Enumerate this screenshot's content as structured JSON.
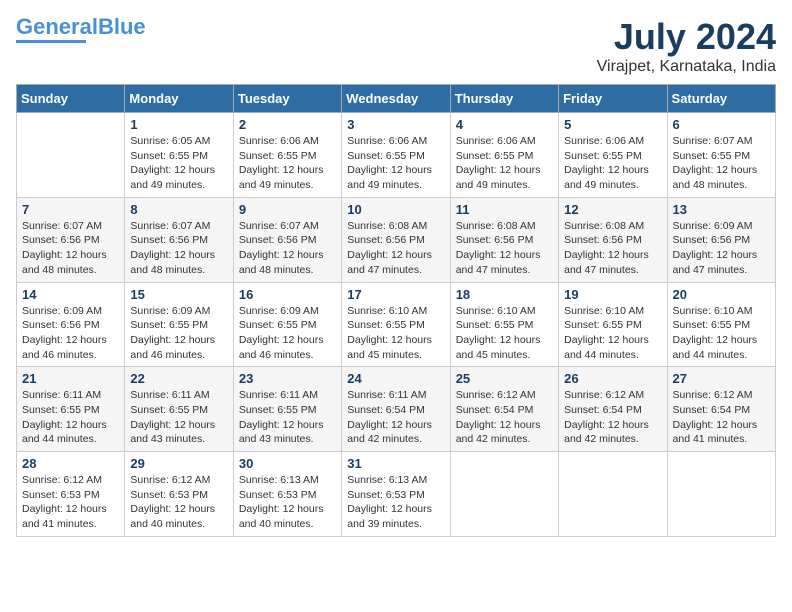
{
  "header": {
    "logo_line1": "General",
    "logo_line2": "Blue",
    "month": "July 2024",
    "location": "Virajpet, Karnataka, India"
  },
  "weekdays": [
    "Sunday",
    "Monday",
    "Tuesday",
    "Wednesday",
    "Thursday",
    "Friday",
    "Saturday"
  ],
  "weeks": [
    [
      {
        "day": "",
        "info": ""
      },
      {
        "day": "1",
        "info": "Sunrise: 6:05 AM\nSunset: 6:55 PM\nDaylight: 12 hours\nand 49 minutes."
      },
      {
        "day": "2",
        "info": "Sunrise: 6:06 AM\nSunset: 6:55 PM\nDaylight: 12 hours\nand 49 minutes."
      },
      {
        "day": "3",
        "info": "Sunrise: 6:06 AM\nSunset: 6:55 PM\nDaylight: 12 hours\nand 49 minutes."
      },
      {
        "day": "4",
        "info": "Sunrise: 6:06 AM\nSunset: 6:55 PM\nDaylight: 12 hours\nand 49 minutes."
      },
      {
        "day": "5",
        "info": "Sunrise: 6:06 AM\nSunset: 6:55 PM\nDaylight: 12 hours\nand 49 minutes."
      },
      {
        "day": "6",
        "info": "Sunrise: 6:07 AM\nSunset: 6:55 PM\nDaylight: 12 hours\nand 48 minutes."
      }
    ],
    [
      {
        "day": "7",
        "info": "Sunrise: 6:07 AM\nSunset: 6:56 PM\nDaylight: 12 hours\nand 48 minutes."
      },
      {
        "day": "8",
        "info": "Sunrise: 6:07 AM\nSunset: 6:56 PM\nDaylight: 12 hours\nand 48 minutes."
      },
      {
        "day": "9",
        "info": "Sunrise: 6:07 AM\nSunset: 6:56 PM\nDaylight: 12 hours\nand 48 minutes."
      },
      {
        "day": "10",
        "info": "Sunrise: 6:08 AM\nSunset: 6:56 PM\nDaylight: 12 hours\nand 47 minutes."
      },
      {
        "day": "11",
        "info": "Sunrise: 6:08 AM\nSunset: 6:56 PM\nDaylight: 12 hours\nand 47 minutes."
      },
      {
        "day": "12",
        "info": "Sunrise: 6:08 AM\nSunset: 6:56 PM\nDaylight: 12 hours\nand 47 minutes."
      },
      {
        "day": "13",
        "info": "Sunrise: 6:09 AM\nSunset: 6:56 PM\nDaylight: 12 hours\nand 47 minutes."
      }
    ],
    [
      {
        "day": "14",
        "info": "Sunrise: 6:09 AM\nSunset: 6:56 PM\nDaylight: 12 hours\nand 46 minutes."
      },
      {
        "day": "15",
        "info": "Sunrise: 6:09 AM\nSunset: 6:55 PM\nDaylight: 12 hours\nand 46 minutes."
      },
      {
        "day": "16",
        "info": "Sunrise: 6:09 AM\nSunset: 6:55 PM\nDaylight: 12 hours\nand 46 minutes."
      },
      {
        "day": "17",
        "info": "Sunrise: 6:10 AM\nSunset: 6:55 PM\nDaylight: 12 hours\nand 45 minutes."
      },
      {
        "day": "18",
        "info": "Sunrise: 6:10 AM\nSunset: 6:55 PM\nDaylight: 12 hours\nand 45 minutes."
      },
      {
        "day": "19",
        "info": "Sunrise: 6:10 AM\nSunset: 6:55 PM\nDaylight: 12 hours\nand 44 minutes."
      },
      {
        "day": "20",
        "info": "Sunrise: 6:10 AM\nSunset: 6:55 PM\nDaylight: 12 hours\nand 44 minutes."
      }
    ],
    [
      {
        "day": "21",
        "info": "Sunrise: 6:11 AM\nSunset: 6:55 PM\nDaylight: 12 hours\nand 44 minutes."
      },
      {
        "day": "22",
        "info": "Sunrise: 6:11 AM\nSunset: 6:55 PM\nDaylight: 12 hours\nand 43 minutes."
      },
      {
        "day": "23",
        "info": "Sunrise: 6:11 AM\nSunset: 6:55 PM\nDaylight: 12 hours\nand 43 minutes."
      },
      {
        "day": "24",
        "info": "Sunrise: 6:11 AM\nSunset: 6:54 PM\nDaylight: 12 hours\nand 42 minutes."
      },
      {
        "day": "25",
        "info": "Sunrise: 6:12 AM\nSunset: 6:54 PM\nDaylight: 12 hours\nand 42 minutes."
      },
      {
        "day": "26",
        "info": "Sunrise: 6:12 AM\nSunset: 6:54 PM\nDaylight: 12 hours\nand 42 minutes."
      },
      {
        "day": "27",
        "info": "Sunrise: 6:12 AM\nSunset: 6:54 PM\nDaylight: 12 hours\nand 41 minutes."
      }
    ],
    [
      {
        "day": "28",
        "info": "Sunrise: 6:12 AM\nSunset: 6:53 PM\nDaylight: 12 hours\nand 41 minutes."
      },
      {
        "day": "29",
        "info": "Sunrise: 6:12 AM\nSunset: 6:53 PM\nDaylight: 12 hours\nand 40 minutes."
      },
      {
        "day": "30",
        "info": "Sunrise: 6:13 AM\nSunset: 6:53 PM\nDaylight: 12 hours\nand 40 minutes."
      },
      {
        "day": "31",
        "info": "Sunrise: 6:13 AM\nSunset: 6:53 PM\nDaylight: 12 hours\nand 39 minutes."
      },
      {
        "day": "",
        "info": ""
      },
      {
        "day": "",
        "info": ""
      },
      {
        "day": "",
        "info": ""
      }
    ]
  ]
}
